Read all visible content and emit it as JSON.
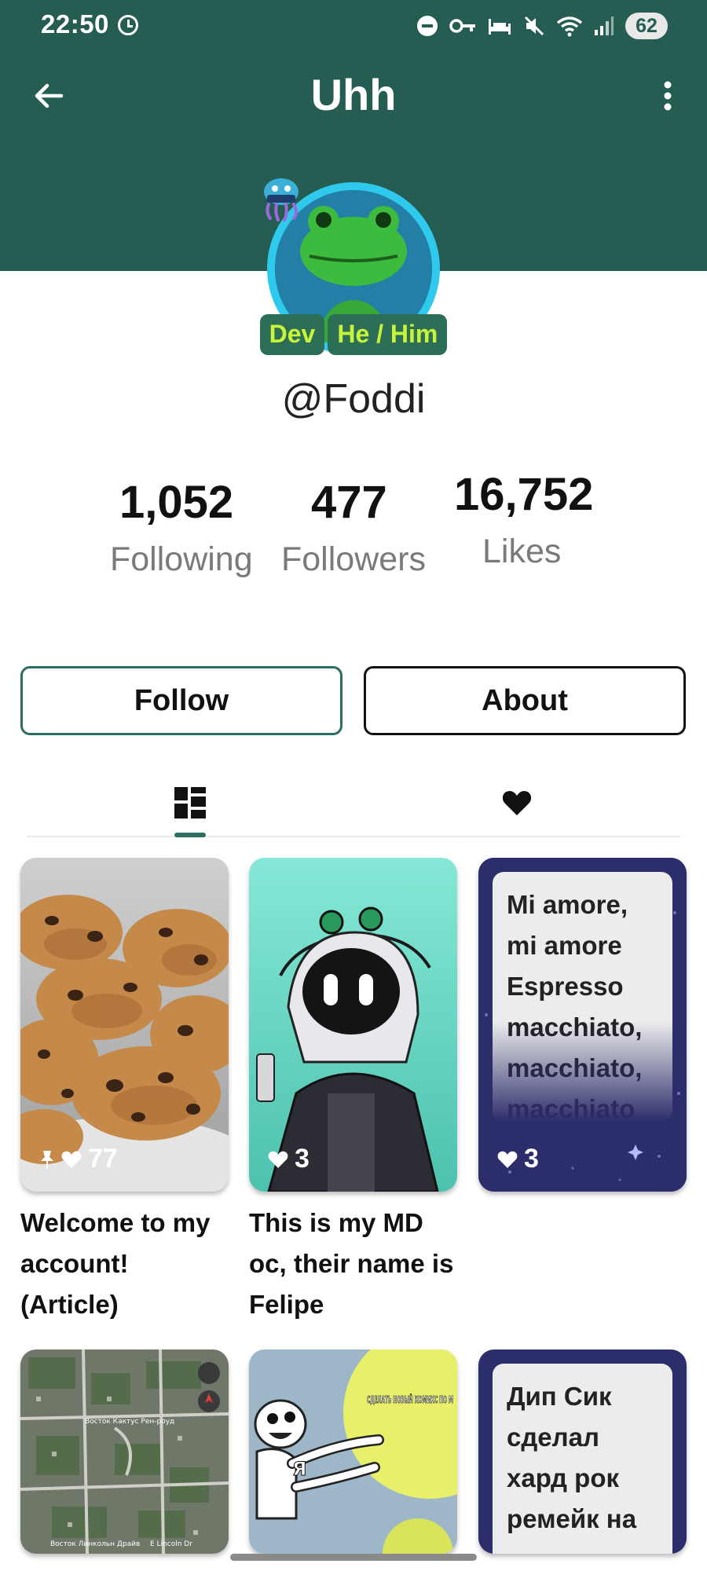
{
  "status_bar": {
    "time": "22:50",
    "battery": "62",
    "icons": [
      "clock-icon",
      "minus-circle-icon",
      "key-icon",
      "bed-icon",
      "mute-icon",
      "wifi-icon",
      "signal-icon"
    ]
  },
  "header": {
    "title": "Uhh",
    "back_icon": "arrow-left-icon",
    "menu_icon": "more-vertical-icon",
    "color": "#265d53"
  },
  "profile": {
    "badges": [
      "Dev",
      "He / Him"
    ],
    "username": "@Foddi",
    "stats": {
      "following": {
        "value": "1,052",
        "label": "Following"
      },
      "followers": {
        "value": "477",
        "label": "Followers"
      },
      "likes": {
        "value": "16,752",
        "label": "Likes"
      }
    }
  },
  "actions": {
    "follow_label": "Follow",
    "about_label": "About"
  },
  "tabs": [
    {
      "name": "posts",
      "icon": "grid-icon",
      "selected": true
    },
    {
      "name": "liked",
      "icon": "heart-icon",
      "selected": false
    }
  ],
  "posts": [
    {
      "title": "Welcome to my account! (Article)",
      "likes": "77",
      "pinned": true,
      "thumb": "cookies-photo"
    },
    {
      "title": "This is my MD oc, their name is Felipe",
      "likes": "3",
      "pinned": false,
      "thumb": "character-drawing"
    },
    {
      "title": "",
      "likes": "3",
      "pinned": false,
      "thumb": "text-post",
      "text": "Mi amore, mi amore Espresso macchiato, macchiato, macchiato"
    },
    {
      "title": "",
      "likes": "",
      "pinned": false,
      "thumb": "satellite-map",
      "map_labels": [
        "Восток Кактус Рен-роуд",
        "Восток Линкольн Драйв",
        "E Lincoln Dr"
      ]
    },
    {
      "title": "",
      "likes": "",
      "pinned": false,
      "thumb": "comic-meme",
      "meme_text": "СДЕЛАТЬ НОВЫЙ КОМИКС ПО М",
      "meme_label": "Я"
    },
    {
      "title": "",
      "likes": "",
      "pinned": false,
      "thumb": "text-post",
      "text": "Дип Сик сделал хард рок ремейк на"
    }
  ],
  "colors": {
    "accent": "#2a6f5f",
    "badge_bg": "#2d6e57",
    "badge_text": "#c8f53a",
    "avatar_ring": "#2fc9ee"
  }
}
